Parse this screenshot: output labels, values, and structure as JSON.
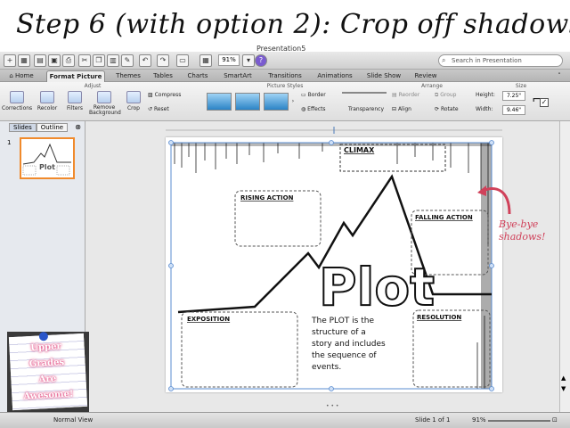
{
  "header": {
    "title": "Step 6 (with option 2): Crop off shadows.",
    "doc_name": "Presentation5"
  },
  "quick_access": {
    "zoom": "91%",
    "search_placeholder": "Search in Presentation"
  },
  "tabs": [
    "Home",
    "Format Picture",
    "Themes",
    "Tables",
    "Charts",
    "SmartArt",
    "Transitions",
    "Animations",
    "Slide Show",
    "Review"
  ],
  "ribbon": {
    "groups": {
      "adjust": "Adjust",
      "picture_styles": "Picture Styles",
      "arrange": "Arrange",
      "size": "Size"
    },
    "buttons": {
      "corrections": "Corrections",
      "recolor": "Recolor",
      "filters": "Filters",
      "remove_background": "Remove Background",
      "crop": "Crop",
      "compress": "Compress",
      "reset": "Reset",
      "border": "Border",
      "effects": "Effects",
      "transparency": "Transparency",
      "reorder": "Reorder",
      "align": "Align",
      "group": "Group",
      "rotate": "Rotate"
    },
    "size": {
      "height_label": "Height:",
      "height_value": "7.25\"",
      "width_label": "Width:",
      "width_value": "9.46\""
    }
  },
  "left_panel": {
    "tab_slides": "Slides",
    "tab_outline": "Outline",
    "slide_number": "1"
  },
  "slide": {
    "climax": "CLIMAX",
    "rising_action": "RISING ACTION",
    "falling_action": "FALLING ACTION",
    "exposition": "EXPOSITION",
    "resolution": "RESOLUTION",
    "plot_word": "Plot",
    "description_lines": [
      "The PLOT is the",
      "structure of a",
      "story and includes",
      "the sequence of",
      "events."
    ]
  },
  "annotation": {
    "line1": "Bye-bye",
    "line2": "shadows!"
  },
  "sticky_note": {
    "line1": "Upper",
    "line2": "Grades",
    "line3": "Are",
    "line4": "Awesome!"
  },
  "status": {
    "view": "Normal View",
    "slide_count": "Slide 1 of 1",
    "zoom": "91%"
  }
}
